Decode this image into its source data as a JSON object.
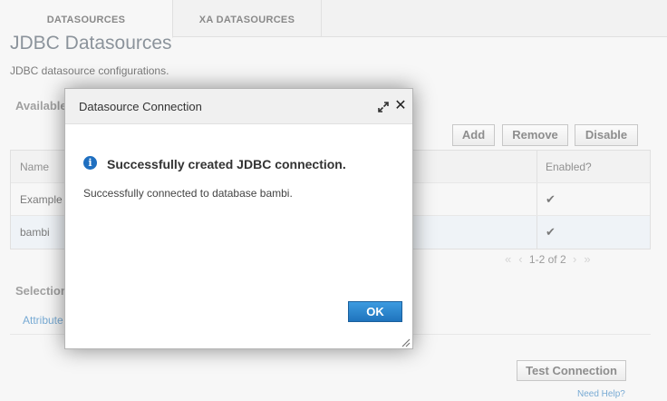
{
  "tabs": [
    {
      "label": "DATASOURCES",
      "active": true
    },
    {
      "label": "XA DATASOURCES",
      "active": false
    }
  ],
  "page": {
    "title": "JDBC Datasources",
    "description": "JDBC datasource configurations.",
    "available_label": "Available",
    "selection_label": "Selection",
    "attributes_link": "Attribute"
  },
  "toolbar": {
    "add_label": "Add",
    "remove_label": "Remove",
    "disable_label": "Disable"
  },
  "table": {
    "columns": [
      "Name",
      "Enabled?"
    ],
    "rows": [
      {
        "name": "Example",
        "enabled": "✔"
      },
      {
        "name": "bambi",
        "enabled": "✔"
      }
    ]
  },
  "pager": {
    "text": "1-2 of 2"
  },
  "footer": {
    "test_connection_label": "Test Connection",
    "help_link": "Need Help?"
  },
  "dialog": {
    "title": "Datasource Connection",
    "heading": "Successfully created JDBC connection.",
    "message": "Successfully connected to database bambi.",
    "ok_label": "OK",
    "icons": {
      "maximize": "maximize-icon",
      "close": "close-icon",
      "info": "info-icon"
    }
  },
  "colors": {
    "accent": "#1f74bd",
    "link": "#2e7dbd",
    "selected_row": "#e6edf3"
  }
}
